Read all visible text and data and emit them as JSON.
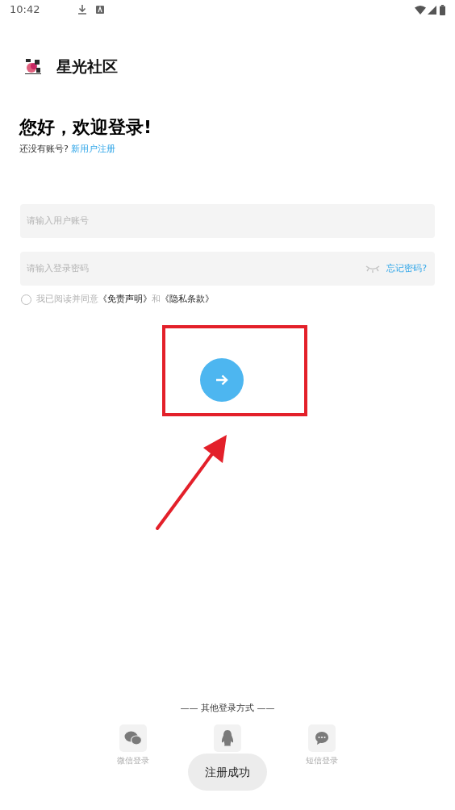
{
  "status_bar": {
    "time": "10:42"
  },
  "brand": {
    "name": "星光社区"
  },
  "greeting": {
    "title": "您好，欢迎登录!",
    "prompt": "还没有账号?",
    "register_link": "新用户注册"
  },
  "fields": [
    {
      "placeholder": "请输入用户账号"
    },
    {
      "placeholder": "请输入登录密码",
      "password_hidden": true,
      "forgot_link": "忘记密码?"
    }
  ],
  "agreement": {
    "checked": false,
    "text": "我已阅读并同意",
    "links": [
      "《免责声明》",
      "《隐私条款》"
    ],
    "conjunction": "和"
  },
  "other_login": {
    "title": "—— 其他登录方式 ——",
    "methods": [
      {
        "kind": "wechat",
        "label": "微信登录"
      },
      {
        "kind": "qq"
      },
      {
        "kind": "sms",
        "label": "短信登录"
      }
    ]
  },
  "toast": "注册成功"
}
